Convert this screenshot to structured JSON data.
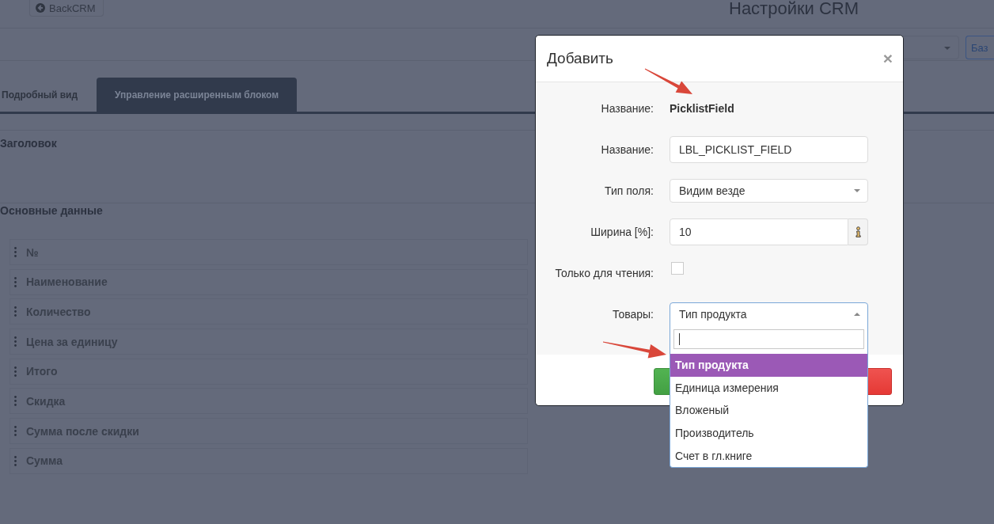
{
  "header": {
    "back_button": "BackCRM",
    "title": "Настройки CRM"
  },
  "toolbar": {
    "button": "Баз"
  },
  "tabs": [
    {
      "label": "Подробный вид",
      "selected": false
    },
    {
      "label": "Управление расширенным блоком",
      "selected": true
    }
  ],
  "sections": [
    {
      "title": "Заголовок"
    },
    {
      "title": "Основные данные",
      "items": [
        "№",
        "Наименование",
        "Количество",
        "Цена за единицу",
        "Итого",
        "Скидка",
        "Сумма после скидки",
        "Сумма"
      ]
    }
  ],
  "modal": {
    "title": "Добавить",
    "close": "×",
    "fields": [
      {
        "kind": "static",
        "label": "Название:",
        "value": "PicklistField"
      },
      {
        "kind": "text",
        "label": "Название:",
        "value": "LBL_PICKLIST_FIELD"
      },
      {
        "kind": "select",
        "label": "Тип поля:",
        "value": "Видим везде",
        "expanded": false
      },
      {
        "kind": "addon",
        "label": "Ширина [%]:",
        "value": "10"
      },
      {
        "kind": "checkbox",
        "label": "Только для чтения:",
        "checked": false
      },
      {
        "kind": "select",
        "label": "Товары:",
        "value": "Тип продукта",
        "expanded": true,
        "options": [
          {
            "label": "Тип продукта",
            "selected": true
          },
          {
            "label": "Единица измерения",
            "selected": false
          },
          {
            "label": "Вложеный",
            "selected": false
          },
          {
            "label": "Производитель",
            "selected": false
          },
          {
            "label": "Счет в гл.книге",
            "selected": false
          }
        ]
      }
    ]
  }
}
